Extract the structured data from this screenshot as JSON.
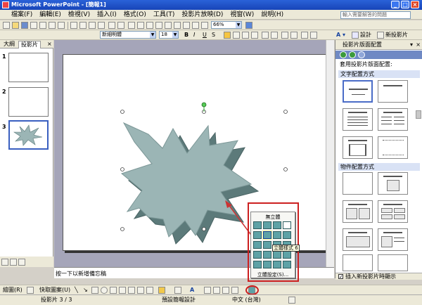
{
  "titlebar": {
    "title": "Microsoft PowerPoint - [簡報1]"
  },
  "menubar": {
    "items": [
      "檔案(F)",
      "編輯(E)",
      "檢視(V)",
      "插入(I)",
      "格式(O)",
      "工具(T)",
      "投影片放映(D)",
      "視窗(W)",
      "說明(H)"
    ],
    "help_placeholder": "輸入需要解答的問題"
  },
  "standard_toolbar": {
    "zoom": "66%"
  },
  "format_toolbar": {
    "font": "新細明體",
    "size": "18",
    "bold": "B",
    "italic": "I",
    "underline": "U",
    "shadow": "S",
    "design_label": "設計",
    "new_slide_label": "新投影片"
  },
  "left_pane": {
    "tabs": [
      "大綱",
      "投影片"
    ],
    "close": "×",
    "slide_numbers": [
      "1",
      "2",
      "3"
    ]
  },
  "notes": {
    "placeholder": "按一下以新增備忘稿"
  },
  "task_pane": {
    "title": "投影片版面配置",
    "subtitle": "套用投影片版面配置:",
    "section_text": "文字配置方式",
    "section_content": "物件配置方式",
    "checkbox_label": "插入新投影片時顯示",
    "checkbox_checked": true
  },
  "popup_3d": {
    "title": "無立體",
    "tooltip": "立體樣式 6",
    "settings": "立體設定(S)..."
  },
  "draw_toolbar": {
    "draw_label": "繪圖(R)",
    "autoshapes_label": "快取圖案(U)"
  },
  "status_bar": {
    "slide_info": "投影片 3 / 3",
    "design": "預設簡報設計",
    "language": "中文 (台灣)"
  },
  "colors": {
    "shape_fill": "#9bb5b5",
    "shape_side": "#5c7a7a",
    "arrow": "#cc3333",
    "highlight": "#cc2020",
    "titlebar": "#1f55c8"
  }
}
